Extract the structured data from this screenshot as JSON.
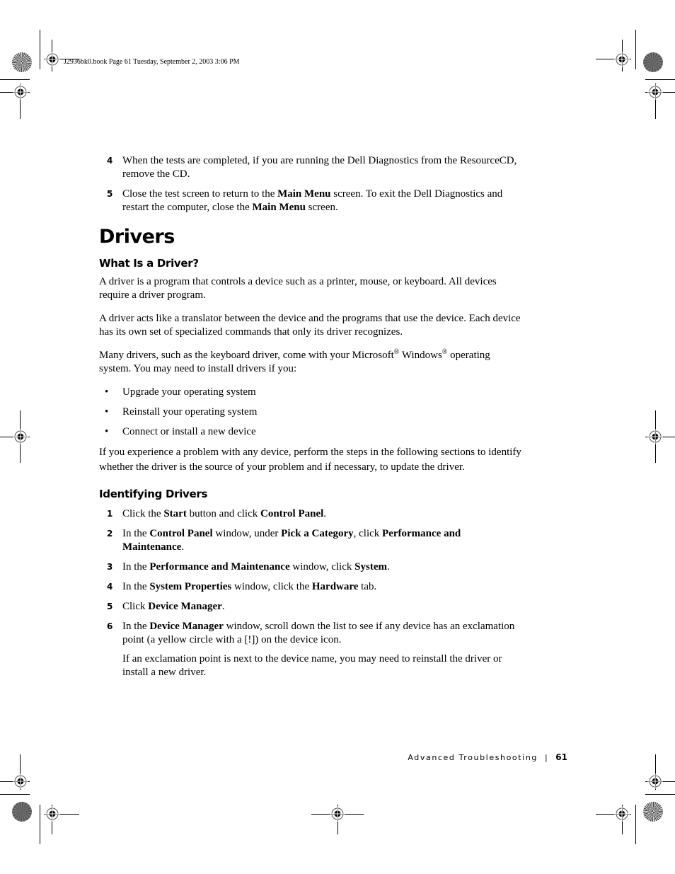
{
  "slug": "J2936bk0.book  Page 61  Tuesday, September 2, 2003  3:06 PM",
  "top_steps": [
    {
      "num": "4",
      "parts": [
        {
          "t": "When the tests are completed, if you are running the Dell Diagnostics from the ResourceCD, remove the CD."
        }
      ]
    },
    {
      "num": "5",
      "parts": [
        {
          "t": "Close the test screen to return to the "
        },
        {
          "t": "Main Menu",
          "b": true
        },
        {
          "t": " screen. To exit the Dell Diagnostics and restart the computer, close the "
        },
        {
          "t": "Main Menu",
          "b": true
        },
        {
          "t": " screen."
        }
      ]
    }
  ],
  "title": "Drivers",
  "what_is": {
    "heading": "What Is a Driver?",
    "p1": "A driver is a program that controls a device such as a printer, mouse, or keyboard. All devices require a driver program.",
    "p2": "A driver acts like a translator between the device and the programs that use the device. Each device has its own set of specialized commands that only its driver recognizes.",
    "p3_a": "Many drivers, such as the keyboard driver, come with your Microsoft",
    "p3_b": " Windows",
    "p3_c": " operating system. You may need to install drivers if you:",
    "reg": "®",
    "bullets": [
      "Upgrade your operating system",
      "Reinstall your operating system",
      "Connect or install a new device"
    ],
    "p4": "If you experience a problem with any device, perform the steps in the following sections to identify whether the driver is the source of your problem and if necessary, to update the driver."
  },
  "identifying": {
    "heading": "Identifying Drivers",
    "steps": [
      {
        "num": "1",
        "parts": [
          {
            "t": "Click the "
          },
          {
            "t": "Start",
            "b": true
          },
          {
            "t": " button and click "
          },
          {
            "t": "Control Panel",
            "b": true
          },
          {
            "t": "."
          }
        ]
      },
      {
        "num": "2",
        "parts": [
          {
            "t": "In the "
          },
          {
            "t": "Control Panel",
            "b": true
          },
          {
            "t": " window, under "
          },
          {
            "t": "Pick a Category",
            "b": true
          },
          {
            "t": ", click "
          },
          {
            "t": "Performance and Maintenance",
            "b": true
          },
          {
            "t": "."
          }
        ]
      },
      {
        "num": "3",
        "parts": [
          {
            "t": "In the "
          },
          {
            "t": "Performance and Maintenance",
            "b": true
          },
          {
            "t": " window, click "
          },
          {
            "t": "System",
            "b": true
          },
          {
            "t": "."
          }
        ]
      },
      {
        "num": "4",
        "parts": [
          {
            "t": "In the "
          },
          {
            "t": "System Properties",
            "b": true
          },
          {
            "t": " window, click the "
          },
          {
            "t": "Hardware",
            "b": true
          },
          {
            "t": " tab."
          }
        ]
      },
      {
        "num": "5",
        "parts": [
          {
            "t": "Click "
          },
          {
            "t": "Device Manager",
            "b": true
          },
          {
            "t": "."
          }
        ]
      },
      {
        "num": "6",
        "parts": [
          {
            "t": "In the "
          },
          {
            "t": "Device Manager",
            "b": true
          },
          {
            "t": " window, scroll down the list to see if any device has an exclamation point (a yellow circle with a [!]) on the device icon."
          }
        ],
        "sub": "If an exclamation point is next to the device name, you may need to reinstall the driver or install a new driver."
      }
    ]
  },
  "footer": {
    "section": "Advanced Troubleshooting",
    "separator": "|",
    "page": "61"
  }
}
